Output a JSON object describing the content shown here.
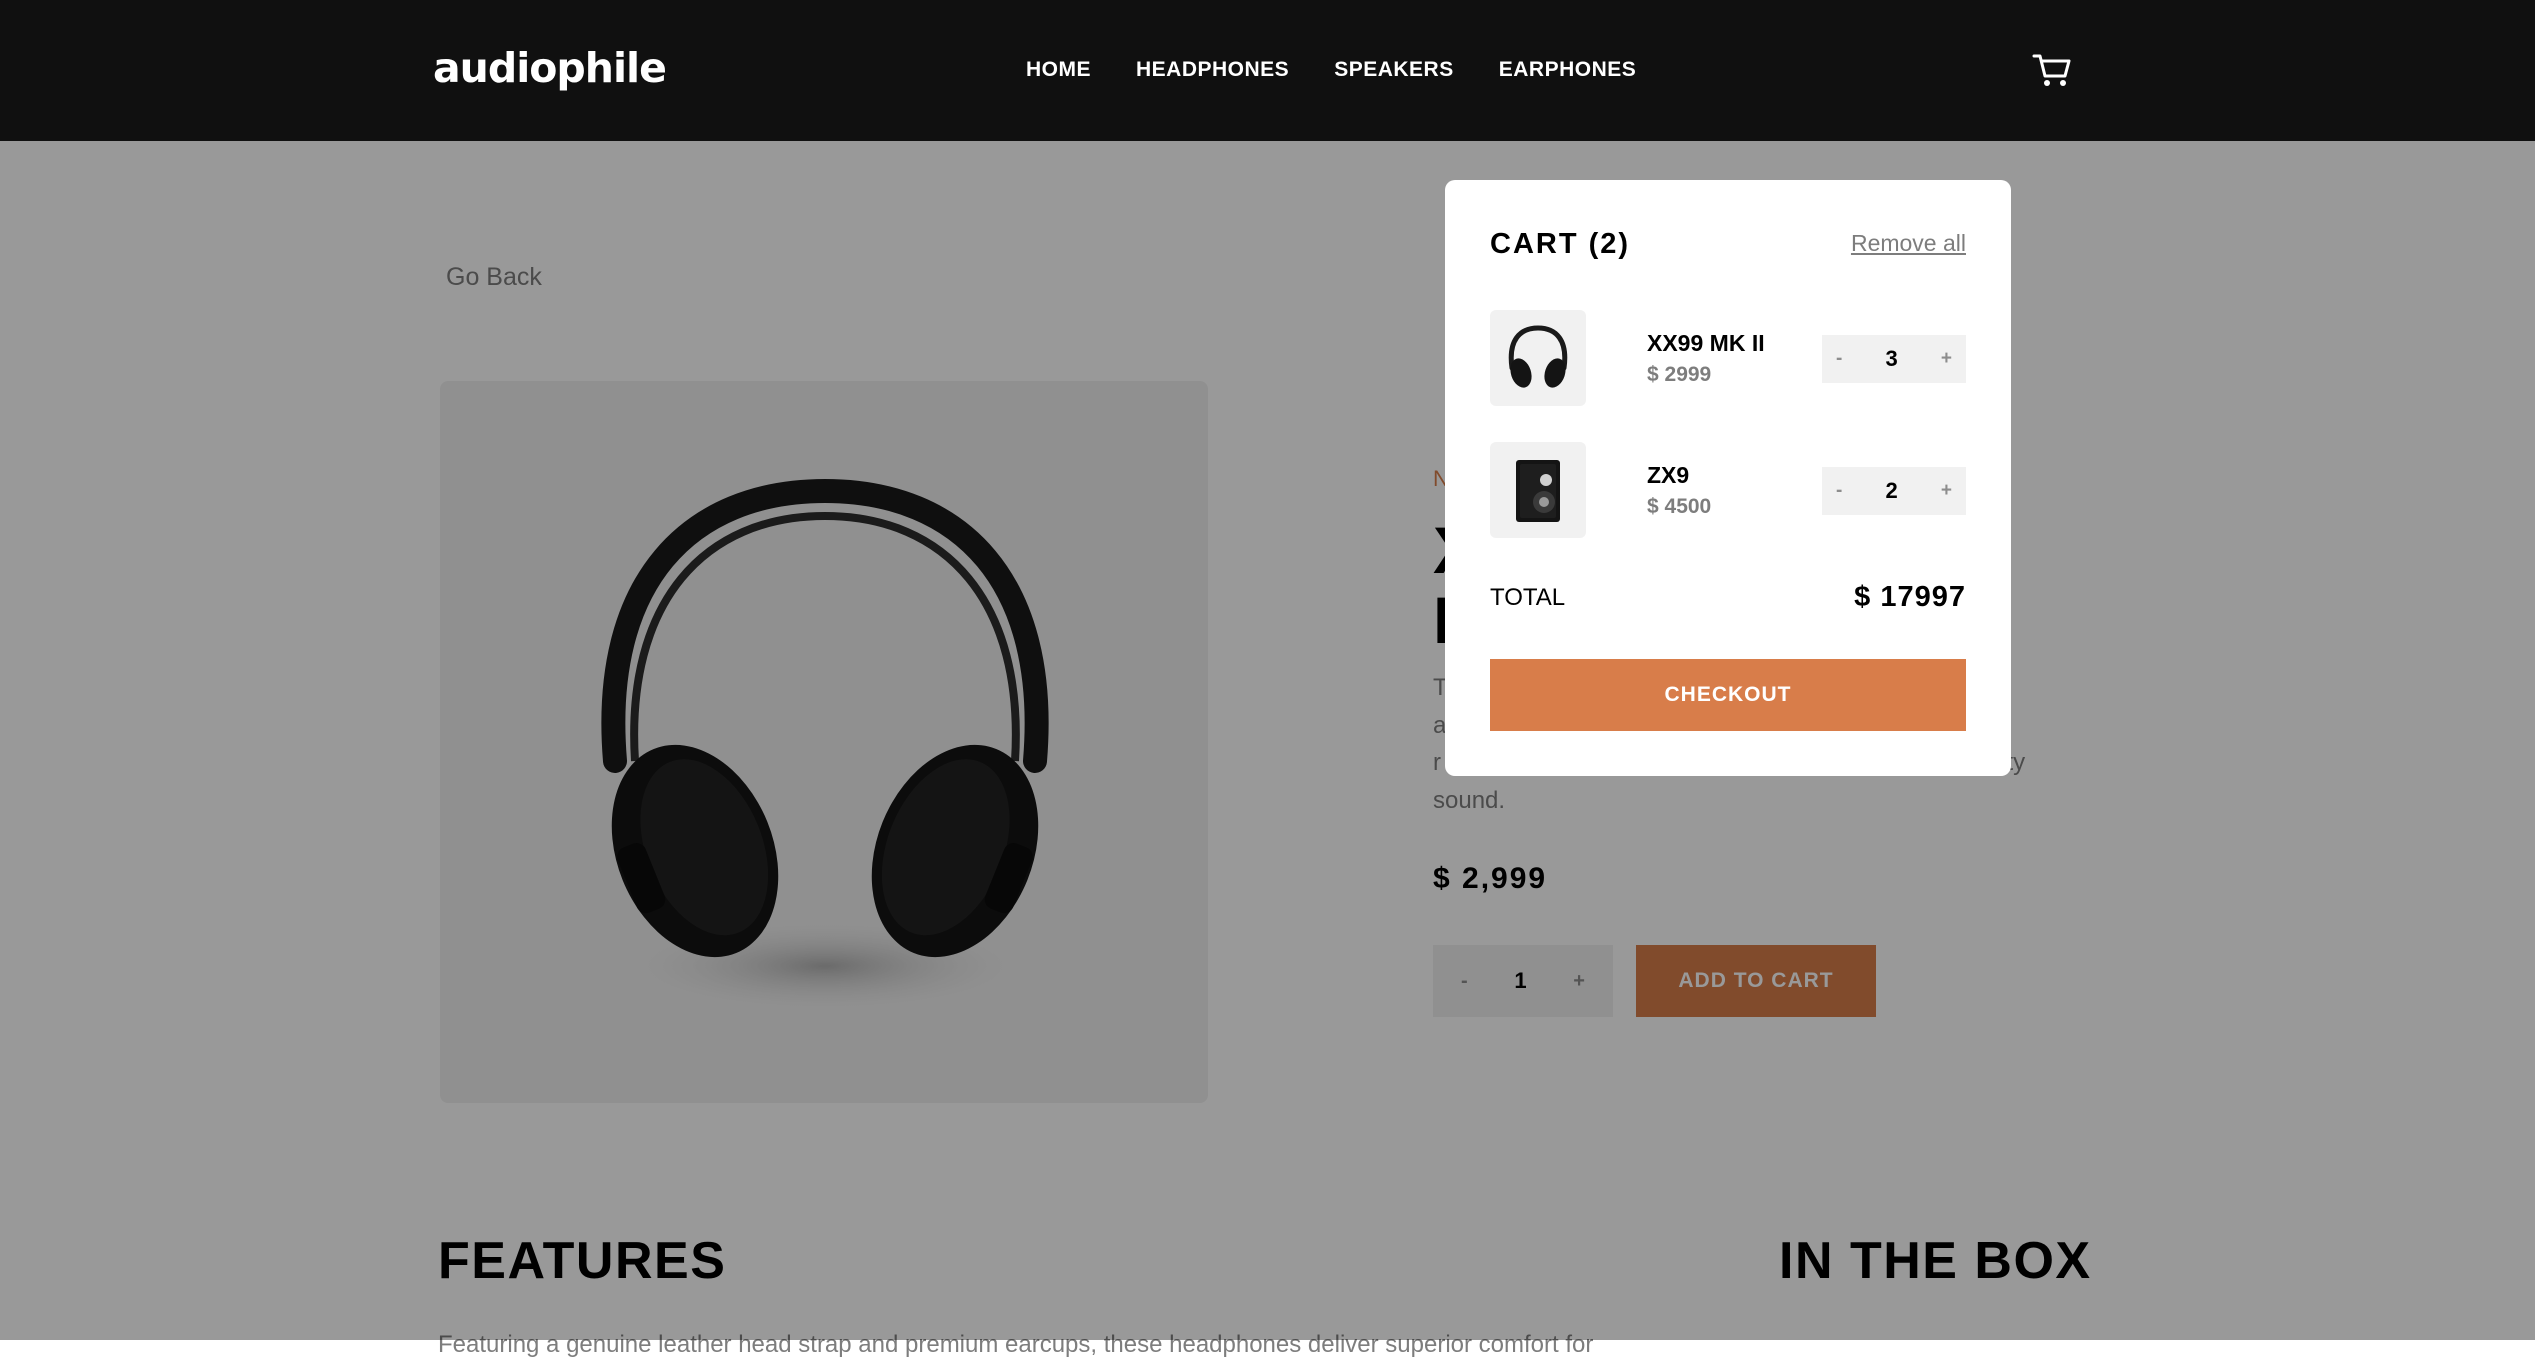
{
  "header": {
    "logo": "audiophile",
    "nav": [
      "HOME",
      "HEADPHONES",
      "SPEAKERS",
      "EARPHONES"
    ],
    "cart_icon": "cart-icon"
  },
  "page": {
    "go_back": "Go Back",
    "new_product_label": "N",
    "title": "X\nH",
    "description": "T                                                                          stine\na                                                                          e by\nr                                                                          o-quality\nsound.",
    "price": "$ 2,999",
    "quantity": {
      "minus": "-",
      "value": "1",
      "plus": "+"
    },
    "add_to_cart": "ADD TO CART",
    "features_title": "FEATURES",
    "in_the_box_title": "IN THE BOX",
    "features_text": "Featuring a genuine leather head strap and premium earcups, these headphones deliver superior comfort for"
  },
  "cart": {
    "title": "CART (2)",
    "remove_all": "Remove all",
    "items": [
      {
        "name": "XX99 MK II",
        "price": "$ 2999",
        "quantity": "3",
        "minus": "-",
        "plus": "+",
        "thumb_icon": "headphones-icon"
      },
      {
        "name": "ZX9",
        "price": "$ 4500",
        "quantity": "2",
        "minus": "-",
        "plus": "+",
        "thumb_icon": "speaker-icon"
      }
    ],
    "total_label": "TOTAL",
    "total_value": "$ 17997",
    "checkout": "CHECKOUT"
  },
  "colors": {
    "accent": "#d87d4a",
    "header_bg": "#101010",
    "overlay": "rgba(0,0,0,0.4)",
    "muted_text": "#7d7d7d",
    "light_bg": "#f1f1f1"
  }
}
